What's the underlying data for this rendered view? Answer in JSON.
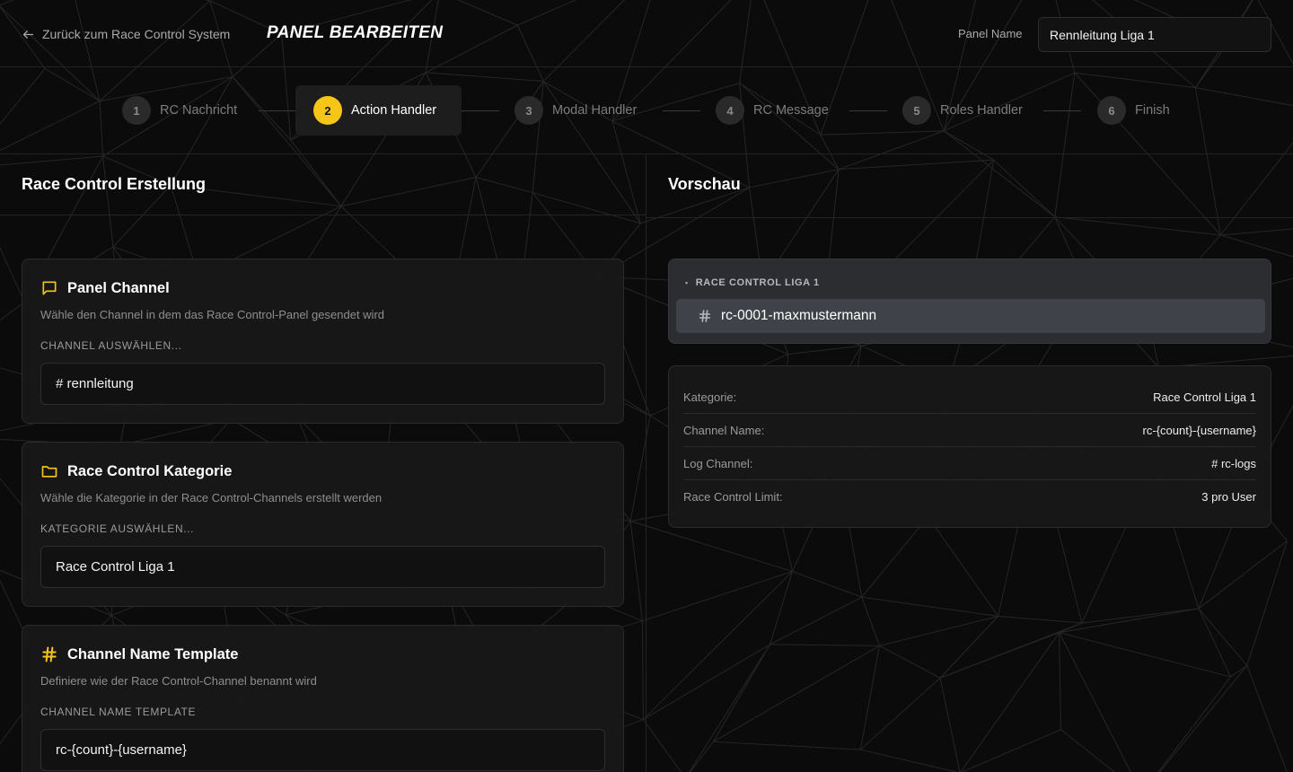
{
  "header": {
    "back_label": "Zurück zum Race Control System",
    "title": "PANEL BEARBEITEN",
    "panel_name_label": "Panel Name",
    "panel_name_value": "Rennleitung Liga 1"
  },
  "stepper": {
    "steps": [
      {
        "num": "1",
        "label": "RC Nachricht",
        "active": false
      },
      {
        "num": "2",
        "label": "Action Handler",
        "active": true
      },
      {
        "num": "3",
        "label": "Modal Handler",
        "active": false
      },
      {
        "num": "4",
        "label": "RC Message",
        "active": false
      },
      {
        "num": "5",
        "label": "Roles Handler",
        "active": false
      },
      {
        "num": "6",
        "label": "Finish",
        "active": false
      }
    ]
  },
  "left": {
    "title": "Race Control Erstellung",
    "cards": [
      {
        "icon": "message-square-icon",
        "title": "Panel Channel",
        "desc": "Wähle den Channel in dem das Race Control-Panel gesendet wird",
        "label": "CHANNEL AUSWÄHLEN...",
        "value": "# rennleitung"
      },
      {
        "icon": "folder-icon",
        "title": "Race Control Kategorie",
        "desc": "Wähle die Kategorie in der Race Control-Channels erstellt werden",
        "label": "KATEGORIE AUSWÄHLEN...",
        "value": "Race Control Liga 1"
      },
      {
        "icon": "hash-icon",
        "title": "Channel Name Template",
        "desc": "Definiere wie der Race Control-Channel benannt wird",
        "label": "CHANNEL NAME TEMPLATE",
        "value": "rc-{count}-{username}"
      }
    ]
  },
  "preview": {
    "title": "Vorschau",
    "category_name": "RACE CONTROL LIGA 1",
    "channel_name": "rc-0001-maxmustermann",
    "info": [
      {
        "key": "Kategorie:",
        "value": "Race Control Liga 1"
      },
      {
        "key": "Channel Name:",
        "value": "rc-{count}-{username}"
      },
      {
        "key": "Log Channel:",
        "value": "# rc-logs"
      },
      {
        "key": "Race Control Limit:",
        "value": "3 pro User"
      }
    ]
  },
  "colors": {
    "accent": "#f5c518",
    "background": "#0b0b0b",
    "card": "#181818",
    "discord_bg": "#2b2d31",
    "discord_selected": "#404249"
  }
}
